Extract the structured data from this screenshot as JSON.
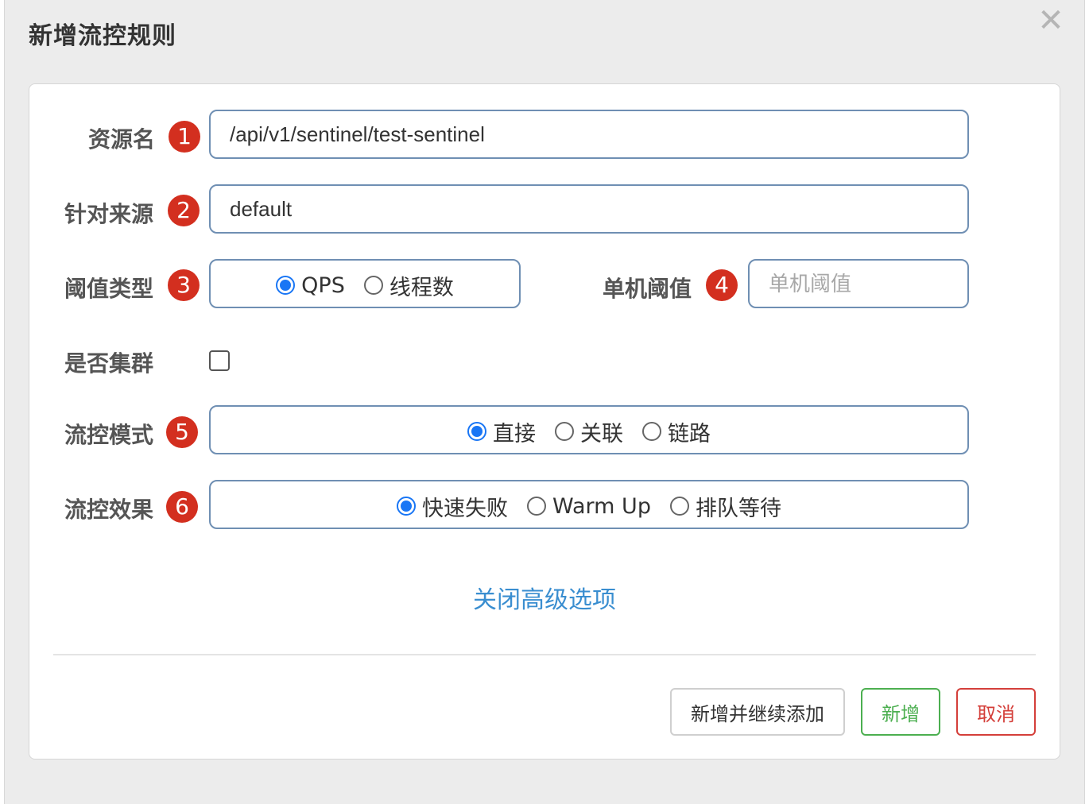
{
  "dialog": {
    "title": "新增流控规则",
    "close_glyph": "✕"
  },
  "form": {
    "resource": {
      "label": "资源名",
      "badge": "1",
      "value": "/api/v1/sentinel/test-sentinel"
    },
    "limit_app": {
      "label": "针对来源",
      "badge": "2",
      "value": "default"
    },
    "grade": {
      "label": "阈值类型",
      "badge": "3",
      "options": [
        "QPS",
        "线程数"
      ],
      "selected": "QPS"
    },
    "count": {
      "label": "单机阈值",
      "badge": "4",
      "placeholder": "单机阈值",
      "value": ""
    },
    "cluster": {
      "label": "是否集群",
      "checked": false
    },
    "strategy": {
      "label": "流控模式",
      "badge": "5",
      "options": [
        "直接",
        "关联",
        "链路"
      ],
      "selected": "直接"
    },
    "control_behavior": {
      "label": "流控效果",
      "badge": "6",
      "options": [
        "快速失败",
        "Warm Up",
        "排队等待"
      ],
      "selected": "快速失败"
    },
    "advanced_link": "关闭高级选项"
  },
  "footer": {
    "add_continue": "新增并继续添加",
    "add": "新增",
    "cancel": "取消"
  },
  "colors": {
    "badge": "#d32f1f",
    "radio_selected": "#1976f5",
    "link": "#3a8ed0",
    "success": "#4caf50",
    "danger": "#d43f3a",
    "field_border": "#6f8fb3"
  }
}
